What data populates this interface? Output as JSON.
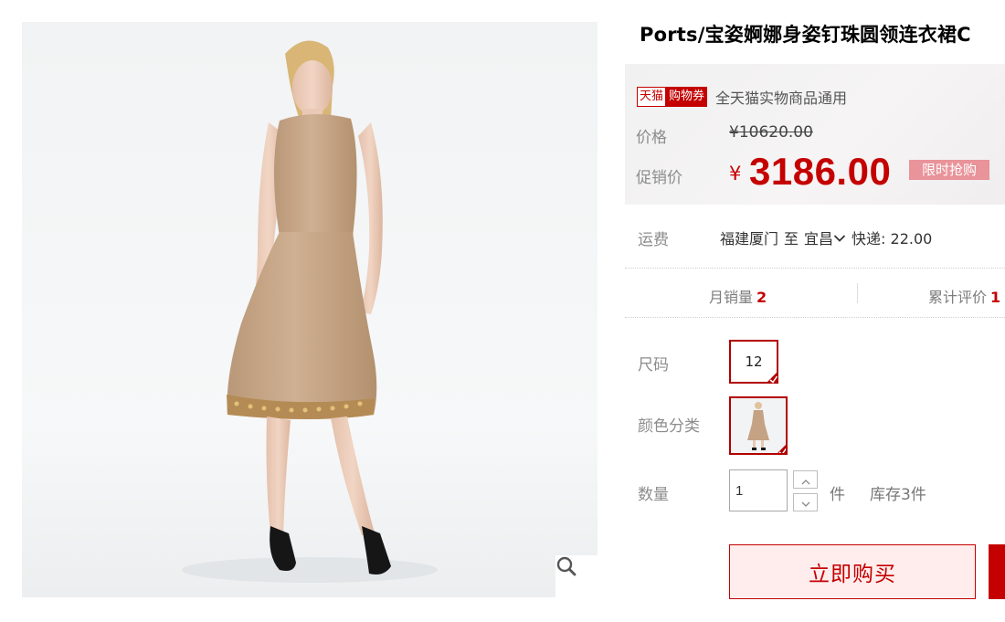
{
  "product": {
    "title": "Ports/宝姿婀娜身姿钉珠圆领连衣裙C"
  },
  "gallery": {
    "image_alt": "模特身穿驼色钉珠圆领连衣裙",
    "zoom_icon": "search-icon"
  },
  "promo": {
    "tmall_tag": "天猫",
    "coupon_tag": "购物券",
    "coupon_text": "全天猫实物商品通用",
    "price_label": "价格",
    "original_price": "¥10620.00",
    "promo_label": "促销价",
    "currency": "¥",
    "promo_price": "3186.00",
    "flash_sale": "限时抢购"
  },
  "shipping": {
    "label": "运费",
    "origin": "福建厦门",
    "to": "至",
    "destination": "宜昌",
    "fee": "快递: 22.00"
  },
  "stats": {
    "monthly_sales_label": "月销量",
    "monthly_sales_value": "2",
    "reviews_label": "累计评价",
    "reviews_value": "1"
  },
  "options": {
    "size_label": "尺码",
    "size_value": "12",
    "color_label": "颜色分类"
  },
  "quantity": {
    "label": "数量",
    "value": "1",
    "unit": "件",
    "stock": "库存3件"
  },
  "actions": {
    "buy_now": "立即购买"
  },
  "colors": {
    "accent": "#c40000",
    "dress": "#c9a98a",
    "flash_tag": "#e9939a"
  }
}
